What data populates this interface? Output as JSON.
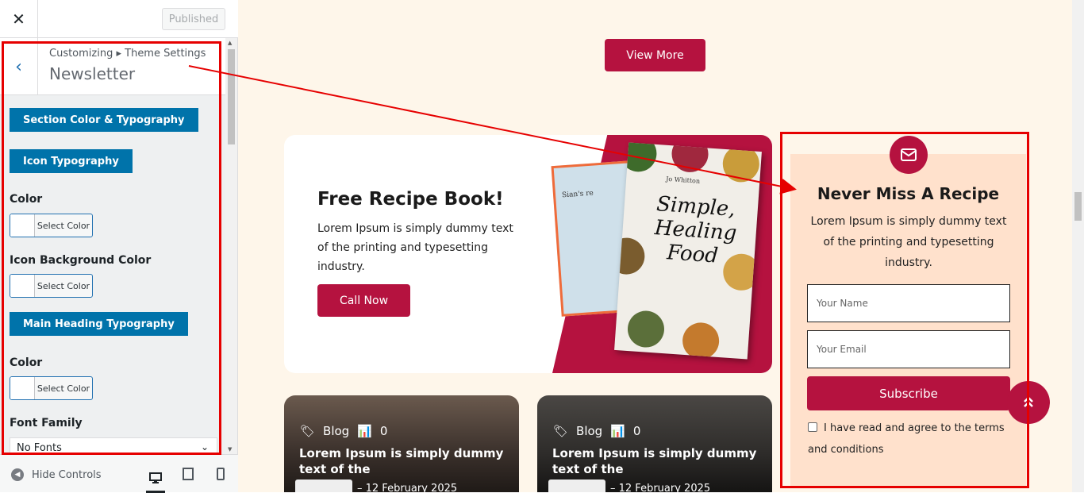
{
  "sidebar": {
    "close_icon": "close-icon",
    "published_label": "Published",
    "breadcrumb": "Customizing ▸ Theme Settings",
    "section_title": "Newsletter",
    "sections": {
      "section_color_typography": "Section Color & Typography",
      "icon_typography": "Icon Typography",
      "color_label_1": "Color",
      "select_color_1": "Select Color",
      "icon_bg_label": "Icon Background Color",
      "select_color_2": "Select Color",
      "main_heading_typography": "Main Heading Typography",
      "color_label_2": "Color",
      "select_color_3": "Select Color",
      "font_family_label": "Font Family",
      "font_family_value": "No Fonts"
    },
    "footer": {
      "hide_controls": "Hide Controls"
    }
  },
  "preview": {
    "view_more": "View More",
    "recipe_card": {
      "title": "Free Recipe Book!",
      "text": "Lorem Ipsum is simply dummy text of the printing and typesetting industry.",
      "call_now": "Call Now",
      "book_title": "Simple, Healing Food",
      "book_author": "Jo Whitton",
      "book_back_text": "Sian's re"
    },
    "newsletter": {
      "title": "Never Miss A Recipe",
      "text": "Lorem Ipsum is simply dummy text of the printing and typesetting industry.",
      "name_placeholder": "Your Name",
      "email_placeholder": "Your Email",
      "subscribe": "Subscribe",
      "terms": "I have read and agree to the terms and conditions"
    },
    "blogs": [
      {
        "category": "Blog",
        "count": "0",
        "title": "Lorem Ipsum is simply dummy text of the",
        "date": "– 12 February 2025"
      },
      {
        "category": "Blog",
        "count": "0",
        "title": "Lorem Ipsum is simply dummy text of the",
        "date": "– 12 February 2025"
      }
    ]
  },
  "colors": {
    "accent": "#b5123f",
    "wp_blue": "#0073aa",
    "annotation": "#e60000",
    "newsletter_bg": "#ffe1cc"
  }
}
